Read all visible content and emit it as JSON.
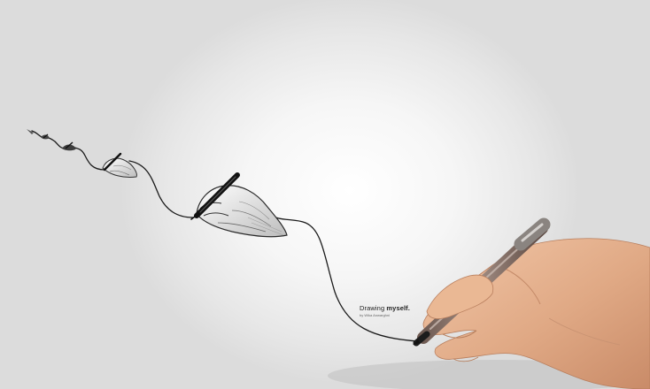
{
  "caption": {
    "title_light": "Drawing",
    "title_bold": "myself.",
    "byline": "by Wika Anwarghni"
  }
}
